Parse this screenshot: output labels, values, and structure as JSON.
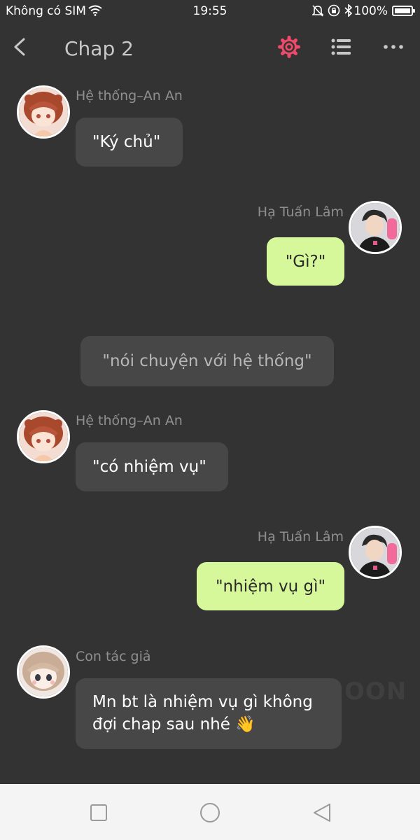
{
  "status_bar": {
    "carrier": "Không có SIM",
    "time": "19:55",
    "battery": "100%",
    "battery_fraction": 1.0
  },
  "header": {
    "title": "Chap 2",
    "icons": [
      "back-icon",
      "gear-icon",
      "list-icon",
      "more-icon"
    ],
    "accent_color": "#f04a6a"
  },
  "messages": [
    {
      "sender": "Hệ thống–An An",
      "text": "\"Ký chủ\"",
      "side": "left",
      "avatar": "anime-girl-avatar"
    },
    {
      "sender": "Hạ Tuấn Lâm",
      "text": "\"Gì?\"",
      "side": "right",
      "avatar": "young-man-avatar"
    },
    {
      "text": "\"nói chuyện với hệ thống\"",
      "side": "narration"
    },
    {
      "sender": "Hệ thống–An An",
      "text": "\"có nhiệm vụ\"",
      "side": "left",
      "avatar": "anime-girl-avatar"
    },
    {
      "sender": "Hạ Tuấn Lâm",
      "text": "\"nhiệm vụ gì\"",
      "side": "right",
      "avatar": "young-man-avatar"
    },
    {
      "sender": "Con tác giả",
      "text": "Mn bt là nhiệm vụ gì không đợi chap sau nhé 👋",
      "side": "left",
      "avatar": "chibi-girl-avatar"
    }
  ],
  "watermark": "OON",
  "colors": {
    "background": "#333333",
    "bubble_left": "#474747",
    "bubble_right": "#d6f79a",
    "navbar": "#f4f4f4"
  },
  "navbar": {
    "icons": [
      "recents-icon",
      "home-icon",
      "back-triangle-icon"
    ]
  }
}
